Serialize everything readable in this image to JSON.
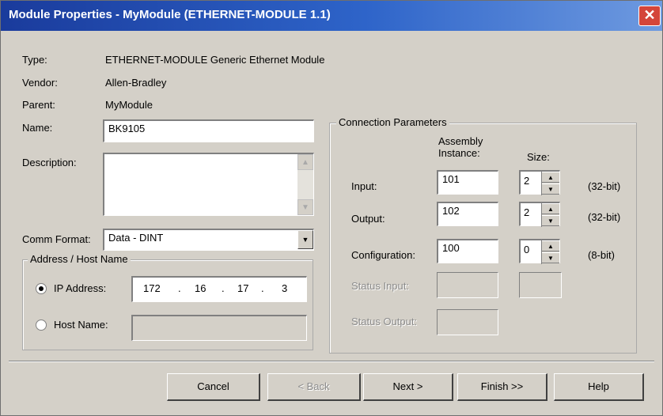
{
  "window": {
    "title": "Module Properties  - MyModule (ETHERNET-MODULE 1.1)",
    "close_glyph": "✕"
  },
  "info": {
    "type_label": "Type:",
    "type_value": "ETHERNET-MODULE Generic Ethernet Module",
    "vendor_label": "Vendor:",
    "vendor_value": "Allen-Bradley",
    "parent_label": "Parent:",
    "parent_value": "MyModule",
    "name_label": "Name:",
    "name_value": "BK9105",
    "description_label": "Description:",
    "description_value": "",
    "comm_format_label": "Comm Format:",
    "comm_format_value": "Data - DINT"
  },
  "address": {
    "group_title": "Address / Host Name",
    "ip_label": "IP Address:",
    "ip_octets": [
      "172",
      "16",
      "17",
      "3"
    ],
    "ip_dot": ".",
    "host_label": "Host Name:",
    "host_value": "",
    "selected": "ip"
  },
  "connection": {
    "group_title": "Connection Parameters",
    "assembly_header": "Assembly\nInstance:",
    "size_header": "Size:",
    "rows": [
      {
        "label": "Input:",
        "instance": "101",
        "size": "2",
        "unit": "(32-bit)"
      },
      {
        "label": "Output:",
        "instance": "102",
        "size": "2",
        "unit": "(32-bit)"
      },
      {
        "label": "Configuration:",
        "instance": "100",
        "size": "0",
        "unit": "(8-bit)"
      }
    ],
    "status_input_label": "Status Input:",
    "status_output_label": "Status Output:"
  },
  "buttons": {
    "cancel": "Cancel",
    "back": "< Back",
    "next": "Next >",
    "finish": "Finish >>",
    "help": "Help"
  },
  "colors": {
    "titlebar": "#1a3b9c",
    "dialog_bg": "#d4d0c8",
    "close_button": "#d4453a"
  }
}
